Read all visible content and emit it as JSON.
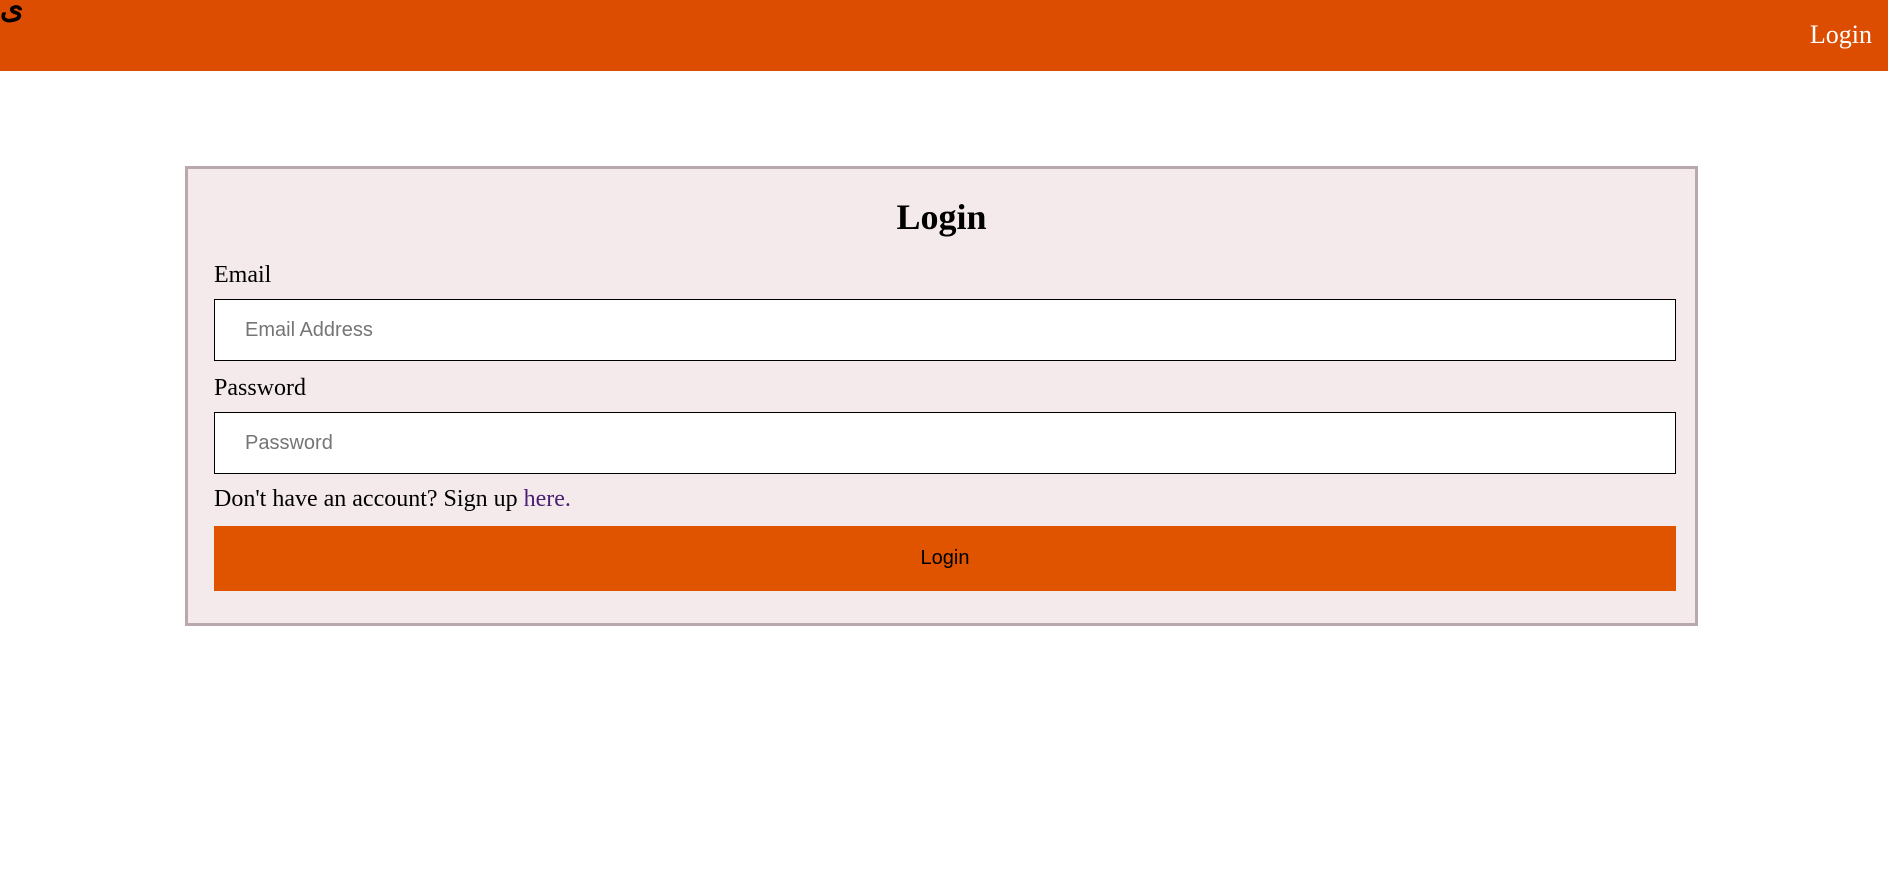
{
  "header": {
    "logo_text": "ى",
    "nav_login_label": "Login",
    "background_color": "#dc4d01"
  },
  "login_form": {
    "title": "Login",
    "email_label": "Email",
    "email_placeholder": "Email Address",
    "email_value": "",
    "password_label": "Password",
    "password_placeholder": "Password",
    "password_value": "",
    "signup_prompt": "Don't have an account? Sign up ",
    "signup_link_label": "here.",
    "submit_label": "Login",
    "card_background": "#f4eaeb",
    "button_color": "#e05400"
  }
}
